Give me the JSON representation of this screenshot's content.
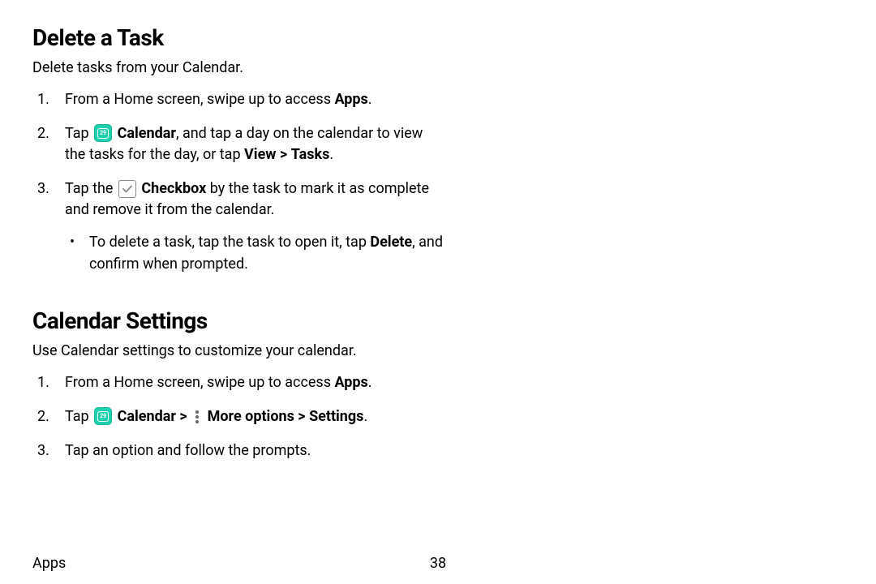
{
  "section1": {
    "heading": "Delete a Task",
    "intro": "Delete tasks from your Calendar.",
    "step1_pre": "From a Home screen, swipe up to access ",
    "step1_bold": "Apps",
    "step1_post": ".",
    "step2_tap": "Tap ",
    "step2_calendar": "Calendar",
    "step2_mid": ", and tap a day on the calendar to view the tasks for the day, or tap ",
    "step2_view": "View",
    "step2_tasks": "Tasks",
    "step2_post": ".",
    "step3_pre": "Tap the ",
    "step3_checkbox": "Checkbox",
    "step3_post": " by the task to mark it as complete and remove it from the calendar.",
    "bullet_pre": "To delete a task, tap the task to open it, tap ",
    "bullet_delete": "Delete",
    "bullet_post": ", and confirm when prompted."
  },
  "section2": {
    "heading": "Calendar Settings",
    "intro": "Use Calendar settings to customize your calendar.",
    "step1_pre": "From a Home screen, swipe up to access ",
    "step1_bold": "Apps",
    "step1_post": ".",
    "step2_tap": "Tap ",
    "step2_calendar": "Calendar",
    "step2_more": "More options",
    "step2_settings": "Settings",
    "step2_post": ".",
    "step3": "Tap an option and follow the prompts."
  },
  "icons": {
    "calendar_day": "29",
    "checkmark": "✓",
    "chevron": ">"
  },
  "footer": {
    "label": "Apps",
    "page": "38"
  }
}
